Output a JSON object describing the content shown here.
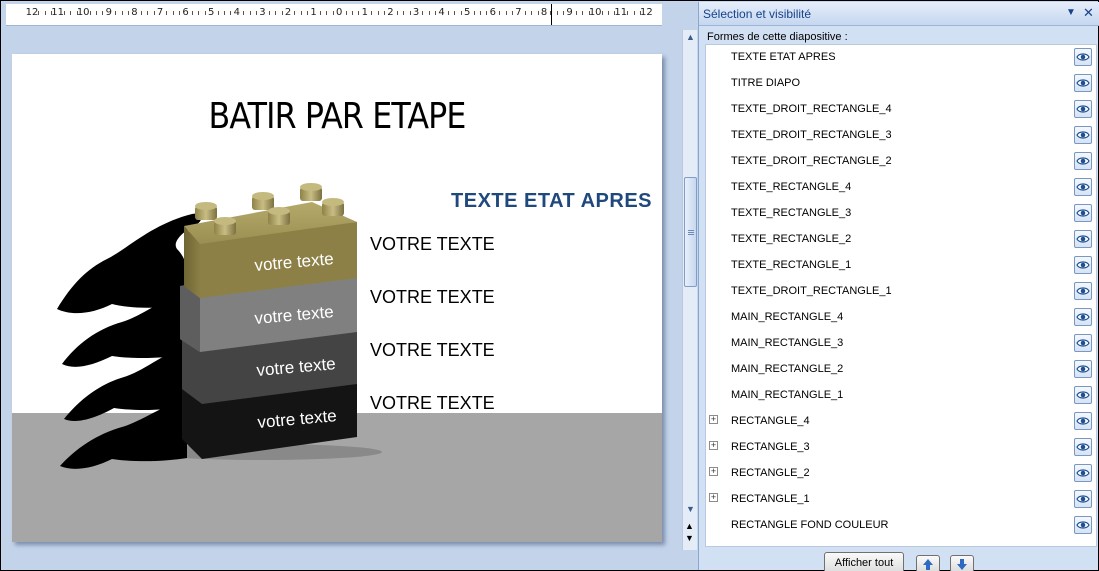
{
  "slide": {
    "title": "BATIR PAR ETAPE",
    "state_after": "TEXTE ETAT APRES",
    "right_texts": [
      "VOTRE TEXTE",
      "VOTRE TEXTE",
      "VOTRE TEXTE",
      "VOTRE TEXTE"
    ],
    "brick_texts": [
      "votre texte",
      "votre texte",
      "votre texte",
      "votre texte"
    ],
    "colors": {
      "title_blue": "#1f497d",
      "brick_gold": "#8c8047",
      "brick_gray": "#7a7a7a",
      "brick_dark": "#404040",
      "brick_black": "#121212",
      "floor": "#a6a6a6"
    }
  },
  "ruler": {
    "labels": [
      "12",
      "11",
      "10",
      "9",
      "8",
      "7",
      "6",
      "5",
      "4",
      "3",
      "2",
      "1",
      "0",
      "1",
      "2",
      "3",
      "4",
      "5",
      "6",
      "7",
      "8",
      "9",
      "10",
      "11",
      "12"
    ]
  },
  "pane": {
    "title": "Sélection et visibilité",
    "menu_icon": "dropdown-arrow-icon",
    "close_icon": "close-icon",
    "shapes_label": "Formes de cette diapositive :",
    "items": [
      {
        "label": "TEXTE ETAT APRES",
        "expandable": false
      },
      {
        "label": "TITRE DIAPO",
        "expandable": false
      },
      {
        "label": "TEXTE_DROIT_RECTANGLE_4",
        "expandable": false
      },
      {
        "label": "TEXTE_DROIT_RECTANGLE_3",
        "expandable": false
      },
      {
        "label": "TEXTE_DROIT_RECTANGLE_2",
        "expandable": false
      },
      {
        "label": "TEXTE_RECTANGLE_4",
        "expandable": false
      },
      {
        "label": "TEXTE_RECTANGLE_3",
        "expandable": false
      },
      {
        "label": "TEXTE_RECTANGLE_2",
        "expandable": false
      },
      {
        "label": "TEXTE_RECTANGLE_1",
        "expandable": false
      },
      {
        "label": "TEXTE_DROIT_RECTANGLE_1",
        "expandable": false
      },
      {
        "label": "MAIN_RECTANGLE_4",
        "expandable": false
      },
      {
        "label": "MAIN_RECTANGLE_3",
        "expandable": false
      },
      {
        "label": "MAIN_RECTANGLE_2",
        "expandable": false
      },
      {
        "label": "MAIN_RECTANGLE_1",
        "expandable": false
      },
      {
        "label": "RECTANGLE_4",
        "expandable": true
      },
      {
        "label": "RECTANGLE_3",
        "expandable": true
      },
      {
        "label": "RECTANGLE_2",
        "expandable": true
      },
      {
        "label": "RECTANGLE_1",
        "expandable": true
      },
      {
        "label": "RECTANGLE FOND COULEUR",
        "expandable": false
      }
    ],
    "show_all_label": "Afficher tout",
    "move_up_icon": "arrow-up-icon",
    "move_down_icon": "arrow-down-icon"
  }
}
